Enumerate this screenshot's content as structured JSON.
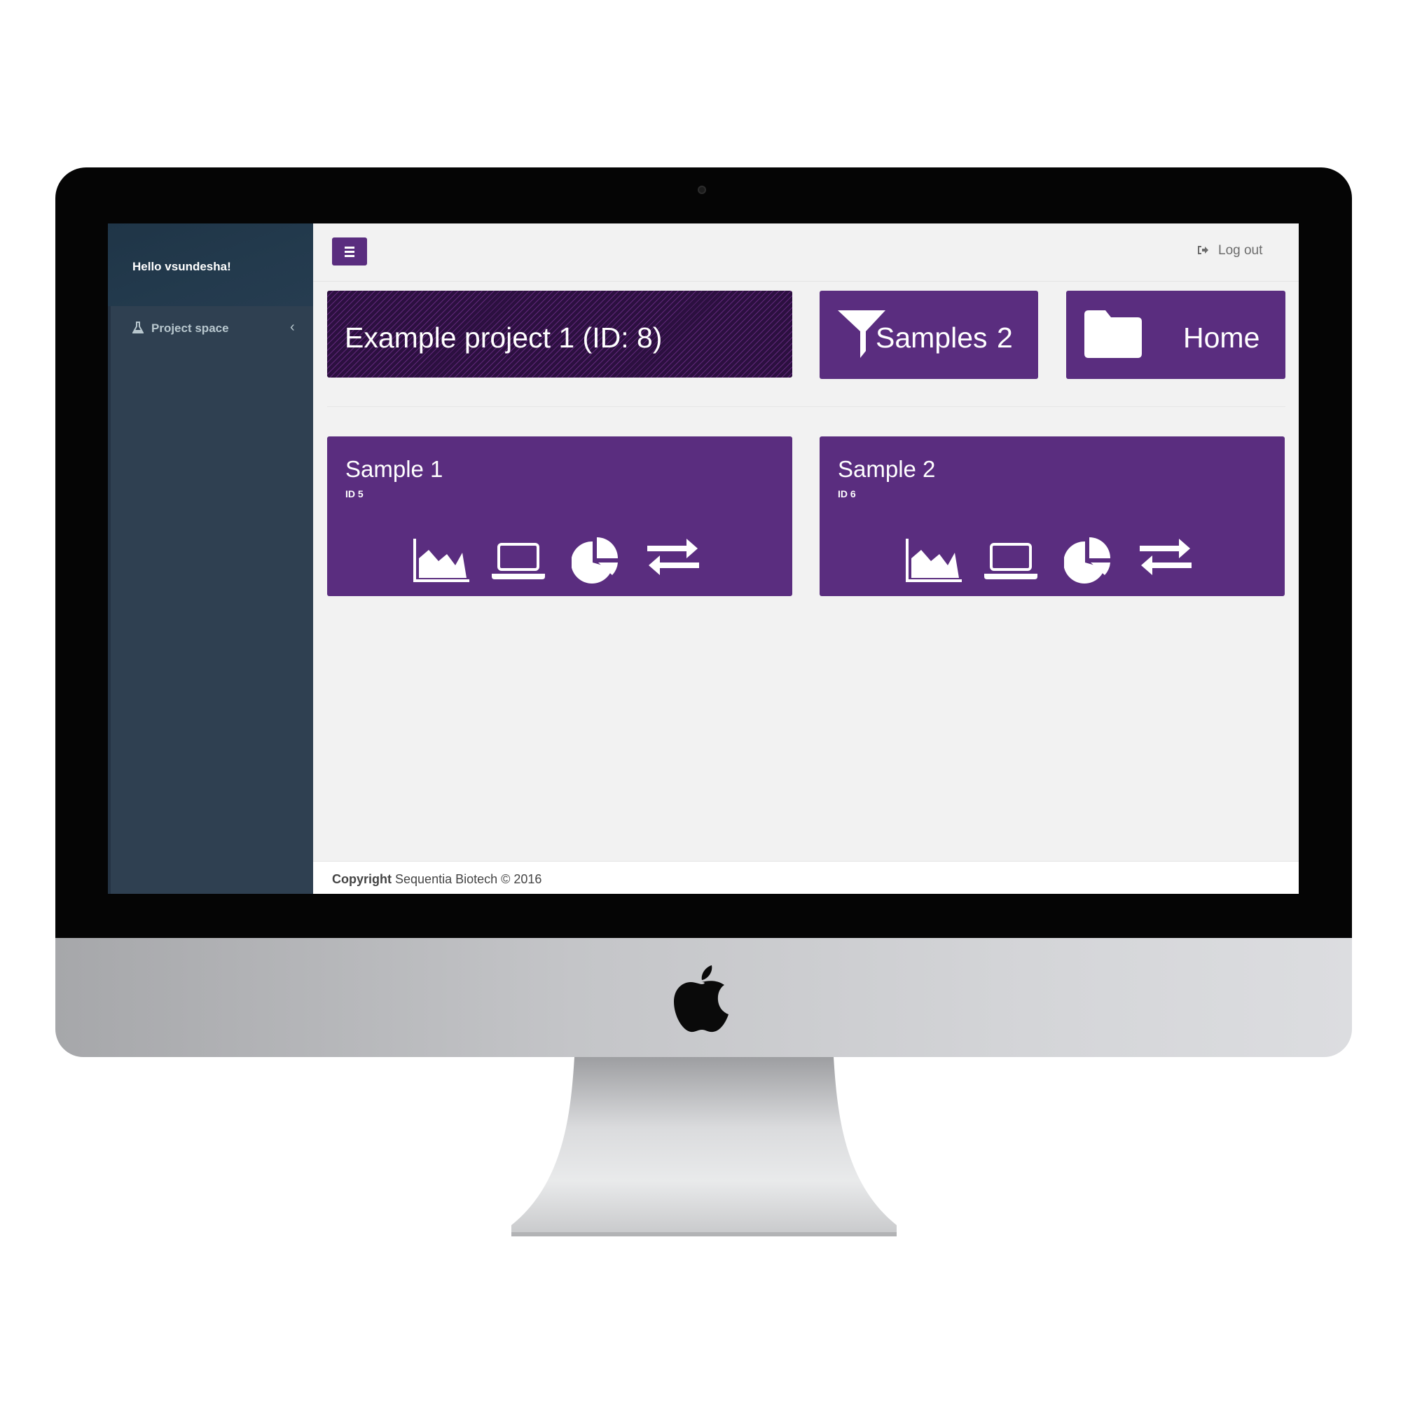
{
  "sidebar": {
    "greeting": "Hello vsundesha!",
    "items": [
      {
        "label": "Project space",
        "icon": "flask-icon",
        "chevron": "‹"
      }
    ]
  },
  "topbar": {
    "menu_icon": "hamburger-menu-icon",
    "logout_label": "Log out",
    "logout_icon": "sign-out-icon"
  },
  "project": {
    "title": "Example project 1 (ID: 8)"
  },
  "samples_tile": {
    "label": "Samples",
    "count": "2",
    "icon": "filter-icon"
  },
  "home_tile": {
    "label": "Home",
    "icon": "folder-icon"
  },
  "samples": [
    {
      "title": "Sample 1",
      "id": "ID 5",
      "actions": [
        "area-chart-icon",
        "laptop-icon",
        "pie-chart-icon",
        "exchange-icon"
      ]
    },
    {
      "title": "Sample 2",
      "id": "ID 6",
      "actions": [
        "area-chart-icon",
        "laptop-icon",
        "pie-chart-icon",
        "exchange-icon"
      ]
    }
  ],
  "footer": {
    "copyright_label": "Copyright",
    "company": "Sequentia Biotech © 2016"
  },
  "colors": {
    "accent": "#5a2d7f",
    "sidebar_bg": "#2f4051",
    "content_bg": "#f2f2f2",
    "sidebar_text": "#b8c7ce"
  }
}
